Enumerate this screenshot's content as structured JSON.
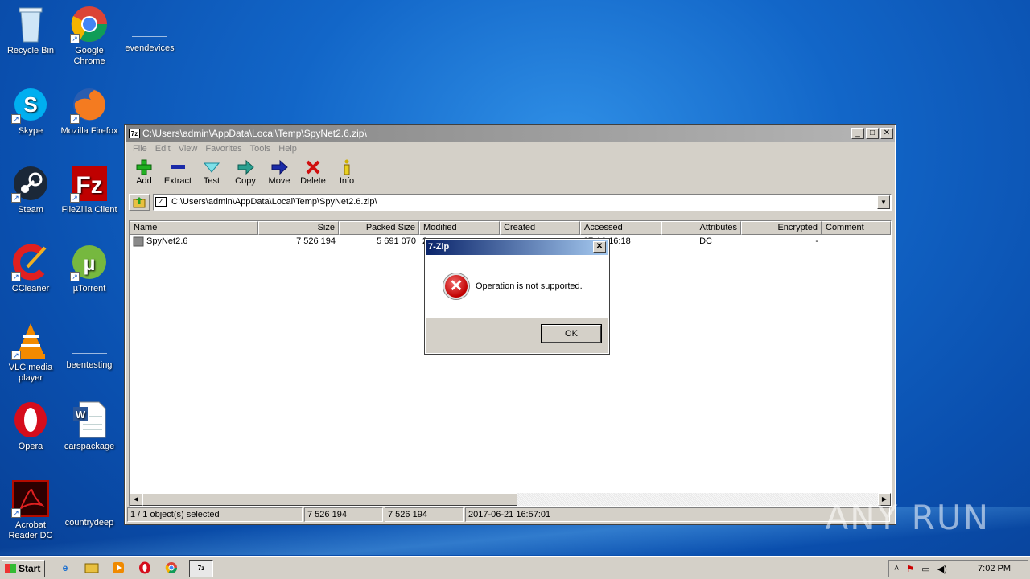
{
  "desktop": {
    "icons": [
      {
        "label": "Recycle Bin"
      },
      {
        "label": "Google Chrome"
      },
      {
        "label": "evendevices"
      },
      {
        "label": "Skype"
      },
      {
        "label": "Mozilla Firefox"
      },
      {
        "label": "Steam"
      },
      {
        "label": "FileZilla Client"
      },
      {
        "label": "CCleaner"
      },
      {
        "label": "µTorrent"
      },
      {
        "label": "VLC media player"
      },
      {
        "label": "beentesting"
      },
      {
        "label": "Opera"
      },
      {
        "label": "carspackage"
      },
      {
        "label": "Acrobat Reader DC"
      },
      {
        "label": "countrydeep"
      }
    ]
  },
  "window": {
    "title": "C:\\Users\\admin\\AppData\\Local\\Temp\\SpyNet2.6.zip\\",
    "menu": [
      "File",
      "Edit",
      "View",
      "Favorites",
      "Tools",
      "Help"
    ],
    "toolbar": [
      {
        "label": "Add",
        "icon": "add-icon"
      },
      {
        "label": "Extract",
        "icon": "extract-icon"
      },
      {
        "label": "Test",
        "icon": "test-icon"
      },
      {
        "label": "Copy",
        "icon": "copy-icon"
      },
      {
        "label": "Move",
        "icon": "move-icon"
      },
      {
        "label": "Delete",
        "icon": "delete-icon"
      },
      {
        "label": "Info",
        "icon": "info-icon"
      }
    ],
    "address": "C:\\Users\\admin\\AppData\\Local\\Temp\\SpyNet2.6.zip\\",
    "columns": [
      "Name",
      "Size",
      "Packed Size",
      "Modified",
      "Created",
      "Accessed",
      "Attributes",
      "Encrypted",
      "Comment"
    ],
    "rows": [
      {
        "name": "SpyNet2.6",
        "size": "7 526 194",
        "packed": "5 691 070",
        "modified": "2",
        "created": "",
        "accessed": "07-16 16:18",
        "attributes": "DC",
        "encrypted": "-",
        "comment": ""
      }
    ],
    "status": {
      "selection": "1 / 1 object(s) selected",
      "size": "7 526 194",
      "packed": "7 526 194",
      "date": "2017-06-21 16:57:01"
    }
  },
  "dialog": {
    "title": "7-Zip",
    "message": "Operation is not supported.",
    "ok": "OK"
  },
  "taskbar": {
    "start": "Start",
    "clock": "7:02 PM"
  },
  "watermark": "ANY RUN"
}
